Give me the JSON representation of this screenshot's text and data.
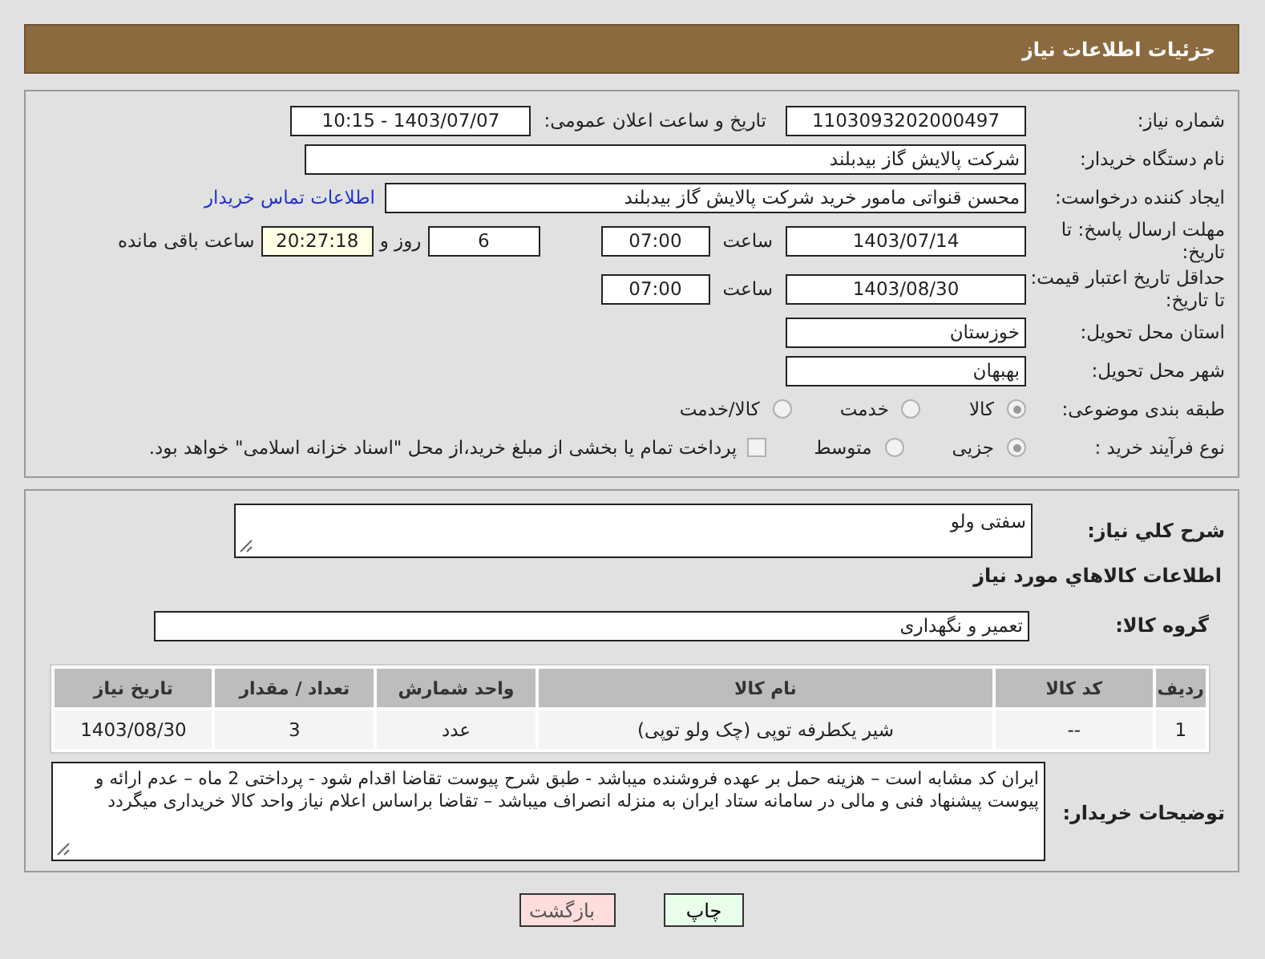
{
  "header": {
    "title": "جزئیات اطلاعات نیاز"
  },
  "need_number": {
    "label": "شماره نیاز:",
    "value": "1103093202000497"
  },
  "announce": {
    "label": "تاریخ و ساعت اعلان عمومی:",
    "value": "1403/07/07 - 10:15"
  },
  "buyer": {
    "label": "نام دستگاه خریدار:",
    "value": "شرکت پالایش گاز بیدبلند"
  },
  "creator": {
    "label": "ایجاد کننده درخواست:",
    "value": "محسن قنواتی مامور خرید شرکت پالایش گاز بیدبلند",
    "link": "اطلاعات تماس خریدار"
  },
  "reply_deadline": {
    "label": "مهلت ارسال پاسخ: تا تاریخ:",
    "date": "1403/07/14",
    "time_label": "ساعت",
    "time": "07:00",
    "days": "6",
    "days_label": "روز و",
    "remaining": "20:27:18",
    "remaining_label": "ساعت باقی مانده"
  },
  "price_validity": {
    "label": "حداقل تاریخ اعتبار قیمت: تا تاریخ:",
    "date": "1403/08/30",
    "time_label": "ساعت",
    "time": "07:00"
  },
  "province": {
    "label": "استان محل تحویل:",
    "value": "خوزستان"
  },
  "city": {
    "label": "شهر محل تحویل:",
    "value": "بهبهان"
  },
  "category": {
    "label": "طبقه بندی موضوعی:",
    "options": [
      {
        "label": "کالا",
        "selected": true
      },
      {
        "label": "خدمت",
        "selected": false
      },
      {
        "label": "کالا/خدمت",
        "selected": false
      }
    ]
  },
  "process": {
    "label": "نوع فرآیند خرید :",
    "options": [
      {
        "label": "جزیی",
        "selected": true
      },
      {
        "label": "متوسط",
        "selected": false
      }
    ],
    "payment": {
      "label": "پرداخت تمام یا بخشی از مبلغ خرید،از محل \"اسناد خزانه اسلامی\" خواهد بود.",
      "checked": false
    }
  },
  "description": {
    "label": "شرح کلي نياز:",
    "value": "سفتی ولو"
  },
  "goods_heading": "اطلاعات كالاهاي مورد نياز",
  "goods_group": {
    "label": "گروه کالا:",
    "value": "تعمیر و نگهداری"
  },
  "table": {
    "columns": [
      "ردیف",
      "کد کالا",
      "نام کالا",
      "واحد شمارش",
      "تعداد / مقدار",
      "تاریخ نیاز"
    ],
    "rows": [
      [
        "1",
        "--",
        "شیر یکطرفه توپی (چک ولو توپی)",
        "عدد",
        "3",
        "1403/08/30"
      ]
    ]
  },
  "notes": {
    "label": "توضیحات خریدار:",
    "value": "ایران کد مشابه است  – هزینه حمل بر عهده فروشنده میباشد -  طبق شرح پیوست تقاضا اقدام شود - پرداختی 2 ماه – عدم ارائه و پیوست  پیشنهاد فنی و مالی در سامانه ستاد ایران به منزله انصراف میباشد  – تقاضا براساس اعلام نیاز واحد کالا خریداری میگردد"
  },
  "buttons": [
    {
      "label": "چاپ",
      "kind": "print"
    },
    {
      "label": "بازگشت",
      "kind": "back"
    }
  ]
}
